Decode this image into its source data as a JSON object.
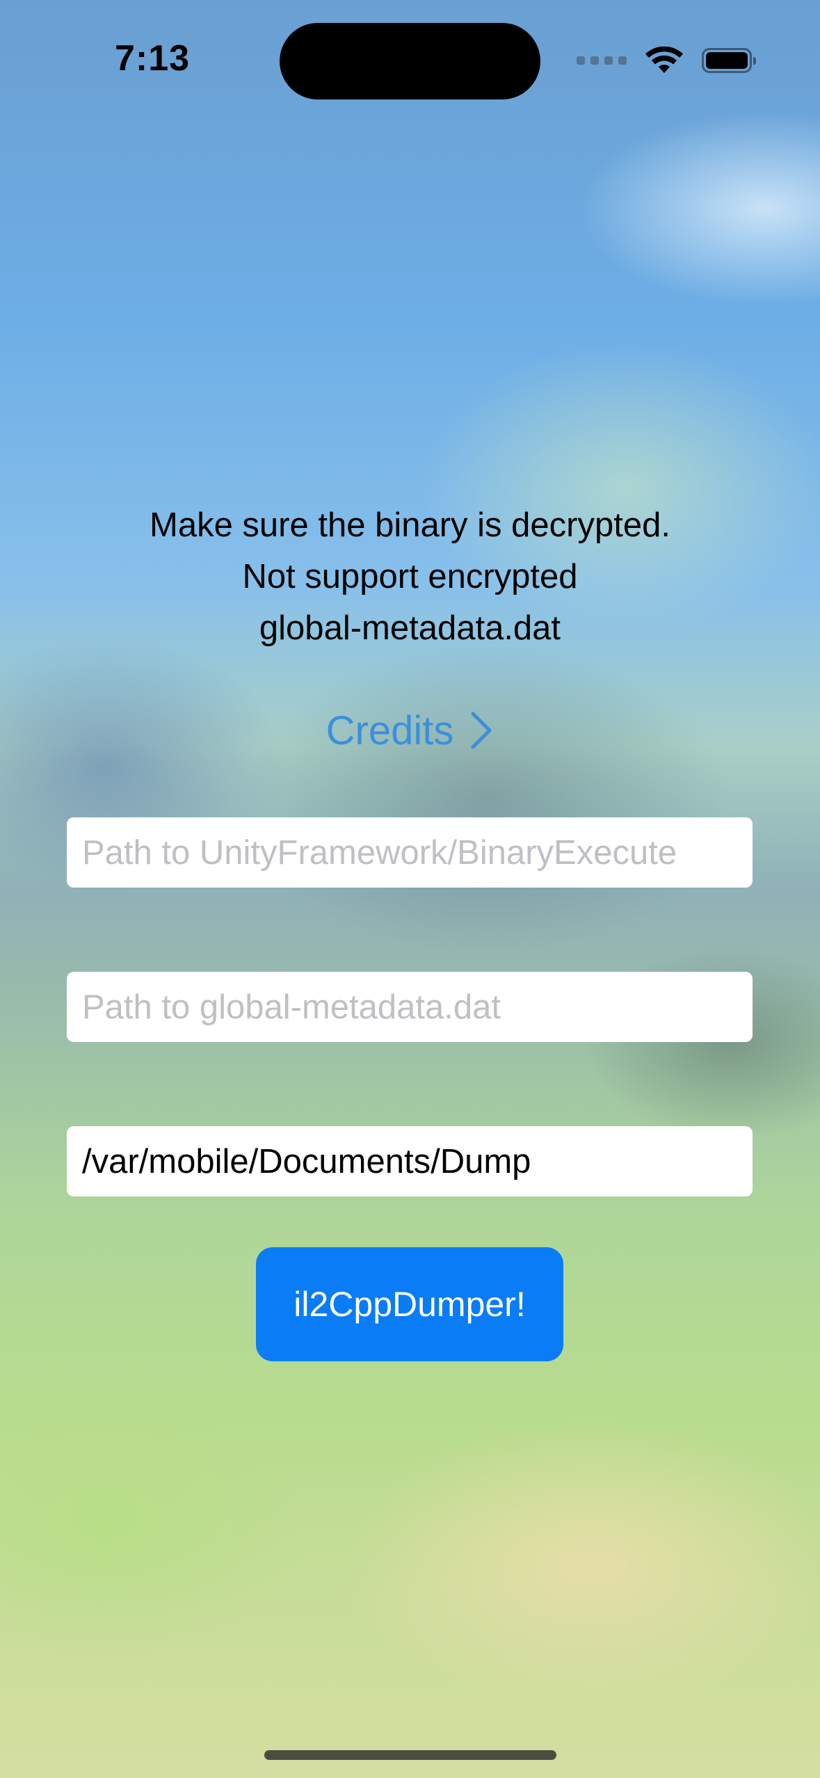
{
  "status_bar": {
    "time": "7:13",
    "icons": [
      "cellular-signal-icon",
      "wifi-icon",
      "battery-icon"
    ]
  },
  "message": {
    "line1": "Make sure the binary is decrypted.",
    "line2": "Not support encrypted",
    "line3": "global-metadata.dat"
  },
  "credits": {
    "label": "Credits",
    "icon": "chevron-right-icon",
    "color": "#3b8fdc"
  },
  "fields": {
    "binary_path": {
      "value": "",
      "placeholder": "Path to UnityFramework/BinaryExecute"
    },
    "metadata_path": {
      "value": "",
      "placeholder": "Path to global-metadata.dat"
    },
    "output_path": {
      "value": "/var/mobile/Documents/Dump",
      "placeholder": ""
    }
  },
  "dump_button": {
    "label": "il2CppDumper!",
    "color": "#0a7cf6"
  }
}
